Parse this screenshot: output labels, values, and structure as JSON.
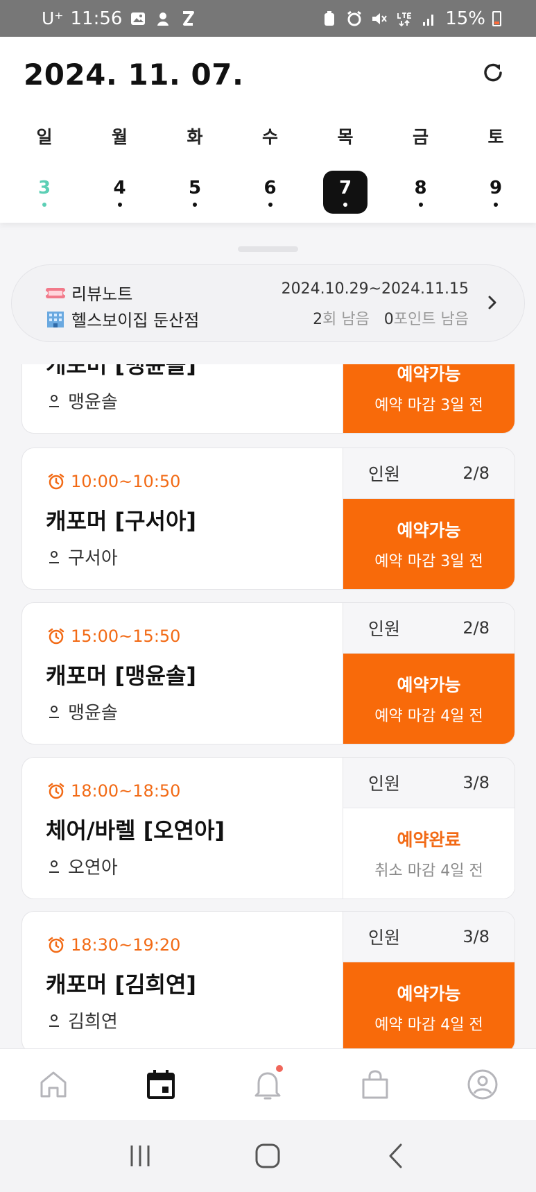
{
  "status_bar": {
    "carrier": "U⁺",
    "time": "11:56",
    "battery": "15%",
    "icons": [
      "gallery-icon",
      "app-notification-icon",
      "z-app-icon",
      "vpn-icon",
      "alarm-icon",
      "mute-icon",
      "lte-icon",
      "signal-icon",
      "battery-icon"
    ]
  },
  "header": {
    "date": "2024. 11. 07.",
    "refresh_icon": "refresh-icon"
  },
  "week": {
    "days": [
      {
        "dow": "일",
        "num": "3",
        "type": "sunday"
      },
      {
        "dow": "월",
        "num": "4",
        "type": "normal"
      },
      {
        "dow": "화",
        "num": "5",
        "type": "normal"
      },
      {
        "dow": "수",
        "num": "6",
        "type": "normal"
      },
      {
        "dow": "목",
        "num": "7",
        "type": "selected"
      },
      {
        "dow": "금",
        "num": "8",
        "type": "normal"
      },
      {
        "dow": "토",
        "num": "9",
        "type": "normal"
      }
    ]
  },
  "pass": {
    "name": "리뷰노트",
    "gym": "헬스보이집 둔산점",
    "period": "2024.10.29~2024.11.15",
    "remain_count": "2",
    "remain_count_suffix": "회 남음",
    "remain_points": "0",
    "remain_points_suffix": "포인트 남음"
  },
  "classes": [
    {
      "time": "",
      "title": "캐포머 [맹윤솔]",
      "coach": "맹윤솔",
      "capacity_label": "",
      "capacity": "",
      "status": "예약가능",
      "status_sub": "예약 마감 3일 전",
      "state": "open"
    },
    {
      "time": "10:00~10:50",
      "title": "캐포머 [구서아]",
      "coach": "구서아",
      "capacity_label": "인원",
      "capacity": "2/8",
      "status": "예약가능",
      "status_sub": "예약 마감 3일 전",
      "state": "open"
    },
    {
      "time": "15:00~15:50",
      "title": "캐포머 [맹윤솔]",
      "coach": "맹윤솔",
      "capacity_label": "인원",
      "capacity": "2/8",
      "status": "예약가능",
      "status_sub": "예약 마감 4일 전",
      "state": "open"
    },
    {
      "time": "18:00~18:50",
      "title": "체어/바렐 [오연아]",
      "coach": "오연아",
      "capacity_label": "인원",
      "capacity": "3/8",
      "status": "예약완료",
      "status_sub": "취소 마감 4일 전",
      "state": "done"
    },
    {
      "time": "18:30~19:20",
      "title": "캐포머 [김희연]",
      "coach": "김희연",
      "capacity_label": "인원",
      "capacity": "3/8",
      "status": "예약가능",
      "status_sub": "예약 마감 4일 전",
      "state": "open"
    }
  ],
  "bottom_nav": {
    "items": [
      {
        "icon": "home-icon",
        "active": false
      },
      {
        "icon": "calendar-icon",
        "active": true
      },
      {
        "icon": "bell-icon",
        "active": false,
        "badge": true
      },
      {
        "icon": "shopping-bag-icon",
        "active": false
      },
      {
        "icon": "profile-icon",
        "active": false
      }
    ]
  },
  "system_nav": [
    "recent-apps-icon",
    "home-button-icon",
    "back-icon"
  ],
  "colors": {
    "accent": "#f86a0a",
    "sunday": "#5ccfb5",
    "selected": "#111111",
    "notification": "#f0665a"
  }
}
